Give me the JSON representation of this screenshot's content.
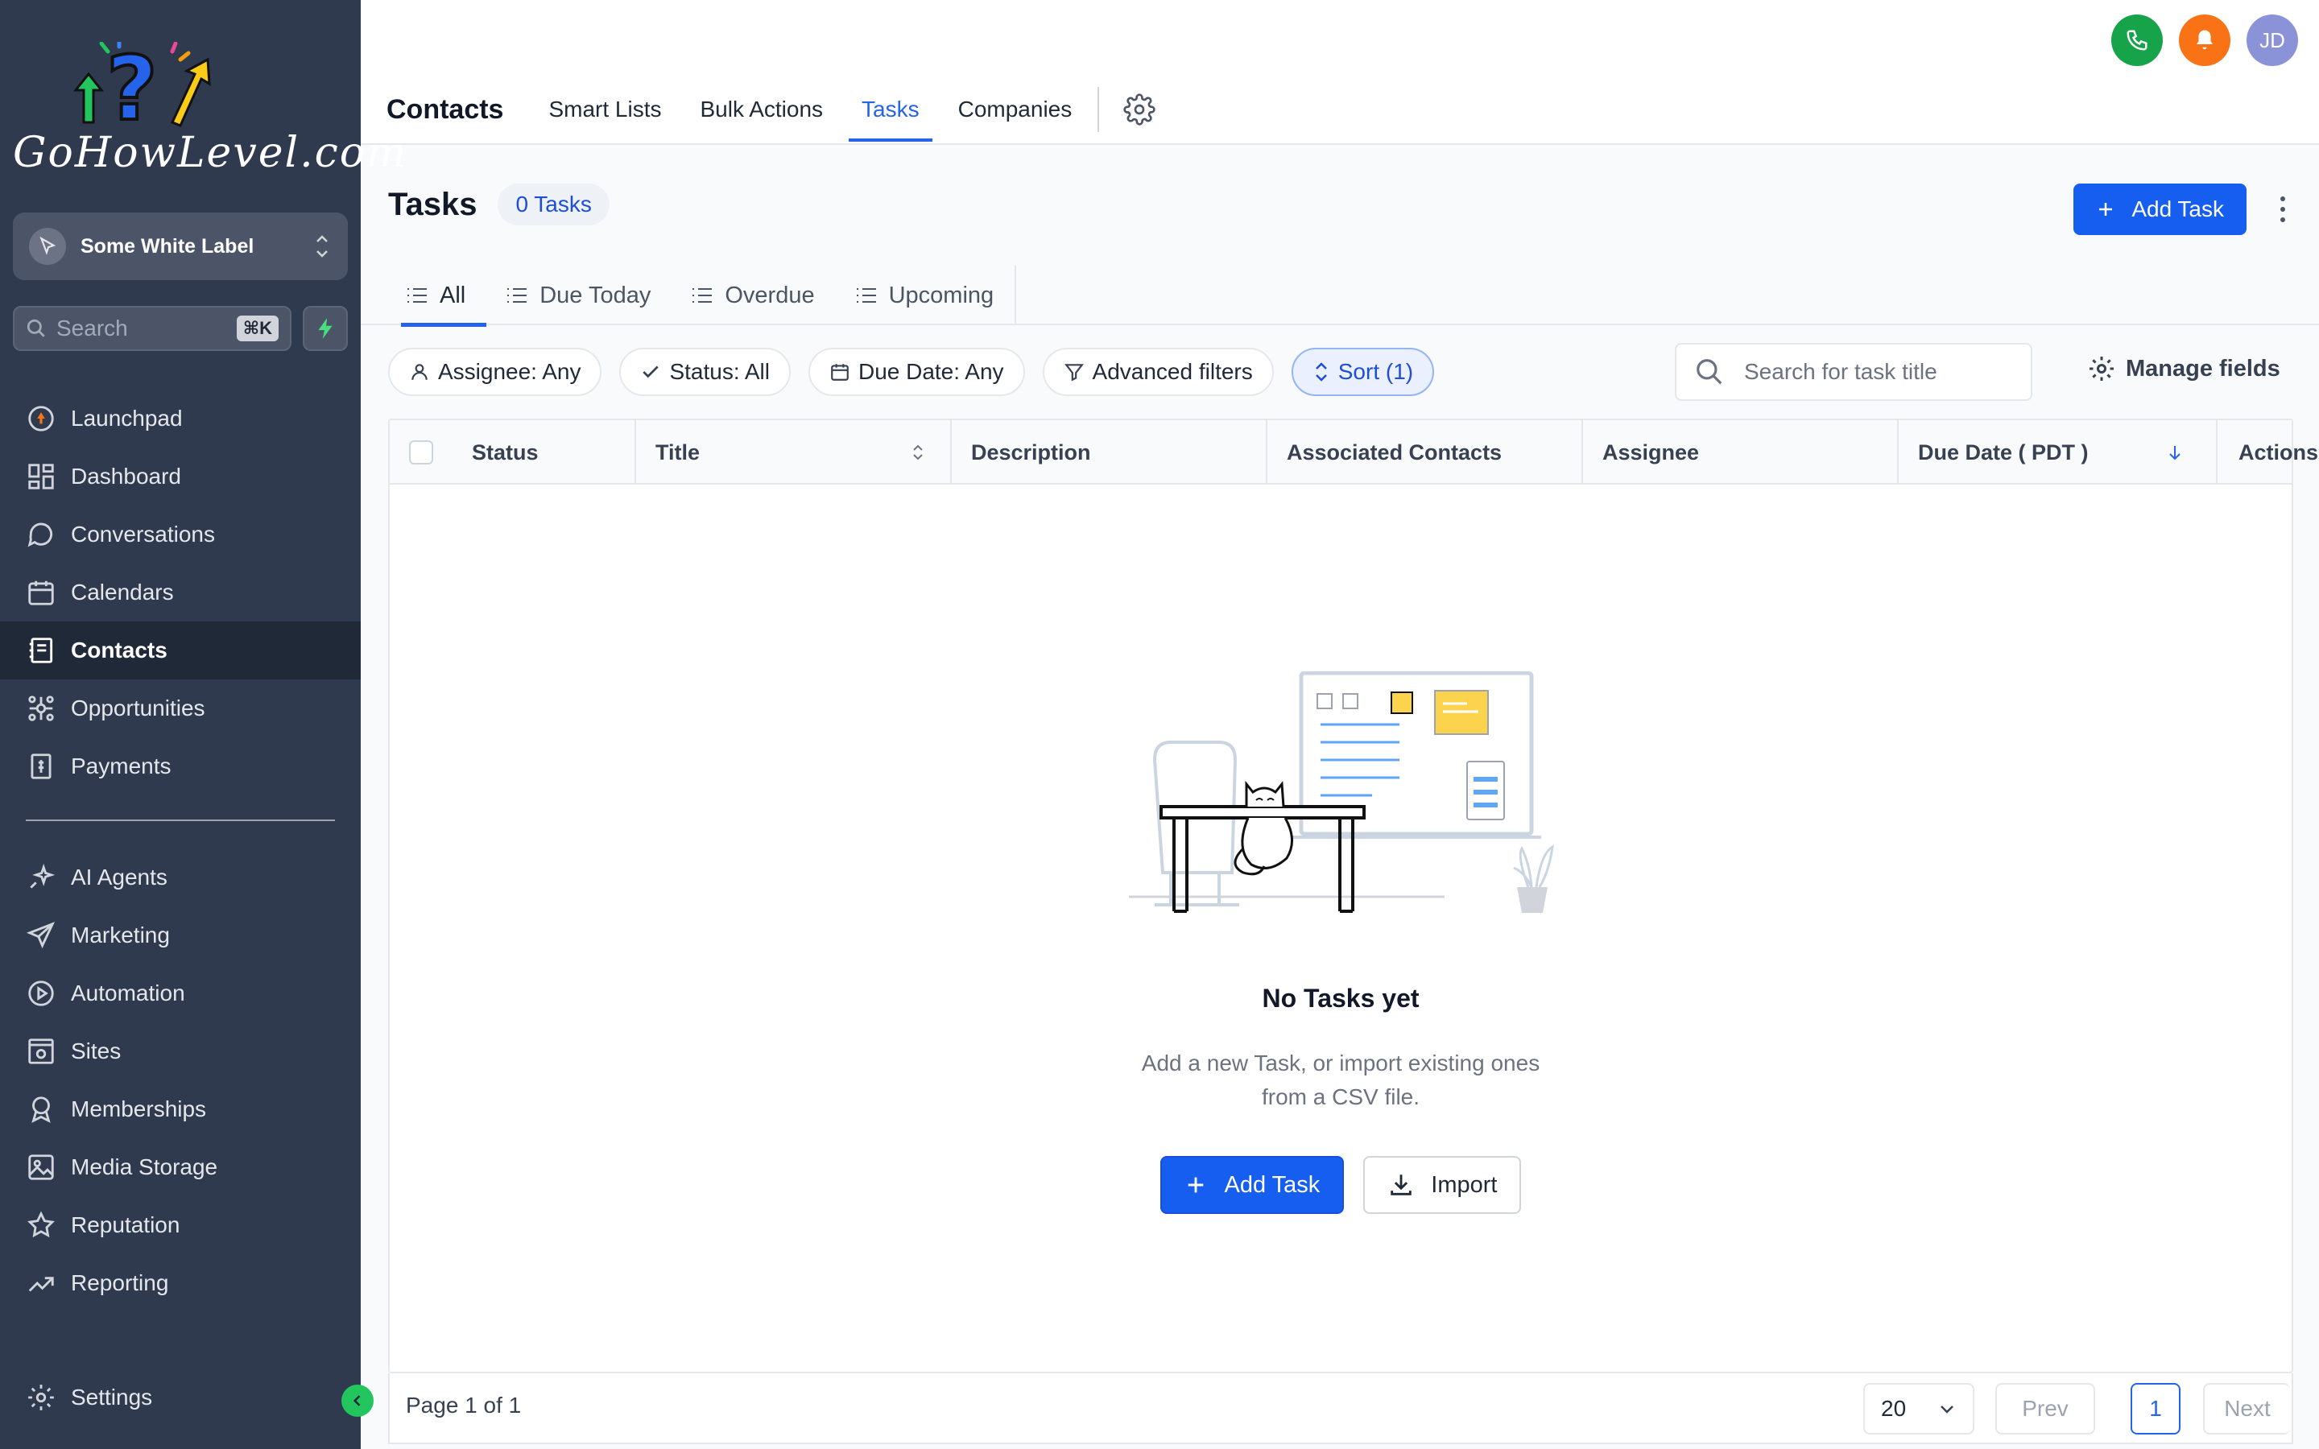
{
  "brand": {
    "logo_text": "GoHowLevel.com"
  },
  "workspace": {
    "label": "Some White Label"
  },
  "sidebar_search": {
    "placeholder": "Search",
    "shortcut": "⌘K"
  },
  "nav": [
    {
      "label": "Launchpad",
      "icon": "rocket-icon"
    },
    {
      "label": "Dashboard",
      "icon": "dashboard-icon"
    },
    {
      "label": "Conversations",
      "icon": "chat-icon"
    },
    {
      "label": "Calendars",
      "icon": "calendar-icon"
    },
    {
      "label": "Contacts",
      "icon": "contacts-icon",
      "active": true
    },
    {
      "label": "Opportunities",
      "icon": "opportunities-icon"
    },
    {
      "label": "Payments",
      "icon": "payments-icon"
    }
  ],
  "nav2": [
    {
      "label": "AI Agents",
      "icon": "sparkle-icon"
    },
    {
      "label": "Marketing",
      "icon": "send-icon"
    },
    {
      "label": "Automation",
      "icon": "automation-icon"
    },
    {
      "label": "Sites",
      "icon": "sites-icon"
    },
    {
      "label": "Memberships",
      "icon": "badge-icon"
    },
    {
      "label": "Media Storage",
      "icon": "image-icon"
    },
    {
      "label": "Reputation",
      "icon": "star-icon"
    },
    {
      "label": "Reporting",
      "icon": "trend-icon"
    }
  ],
  "settings_label": "Settings",
  "header": {
    "title": "Contacts",
    "tabs": [
      "Smart Lists",
      "Bulk Actions",
      "Tasks",
      "Companies"
    ],
    "active_tab": "Tasks",
    "avatar_initials": "JD"
  },
  "page": {
    "title": "Tasks",
    "count_badge": "0 Tasks",
    "add_button": "Add Task"
  },
  "filter_tabs": [
    "All",
    "Due Today",
    "Overdue",
    "Upcoming"
  ],
  "filters": {
    "assignee": "Assignee: Any",
    "status": "Status: All",
    "due_date": "Due Date: Any",
    "advanced": "Advanced filters",
    "sort": "Sort (1)",
    "search_placeholder": "Search for task title",
    "manage_fields": "Manage fields"
  },
  "table": {
    "columns": [
      "Status",
      "Title",
      "Description",
      "Associated Contacts",
      "Assignee",
      "Due Date ( PDT )",
      "Actions"
    ]
  },
  "empty_state": {
    "title": "No Tasks yet",
    "description": "Add a new Task, or import existing ones from a CSV file.",
    "add_button": "Add Task",
    "import_button": "Import"
  },
  "pagination": {
    "page_info": "Page 1 of 1",
    "per_page": "20",
    "prev": "Prev",
    "current": "1",
    "next": "Next"
  },
  "colors": {
    "sidebar_bg": "#2f3a4f",
    "primary": "#155eef",
    "phone_green": "#16a34a",
    "bell_orange": "#f97316",
    "avatar_purple": "#8b93d8"
  }
}
